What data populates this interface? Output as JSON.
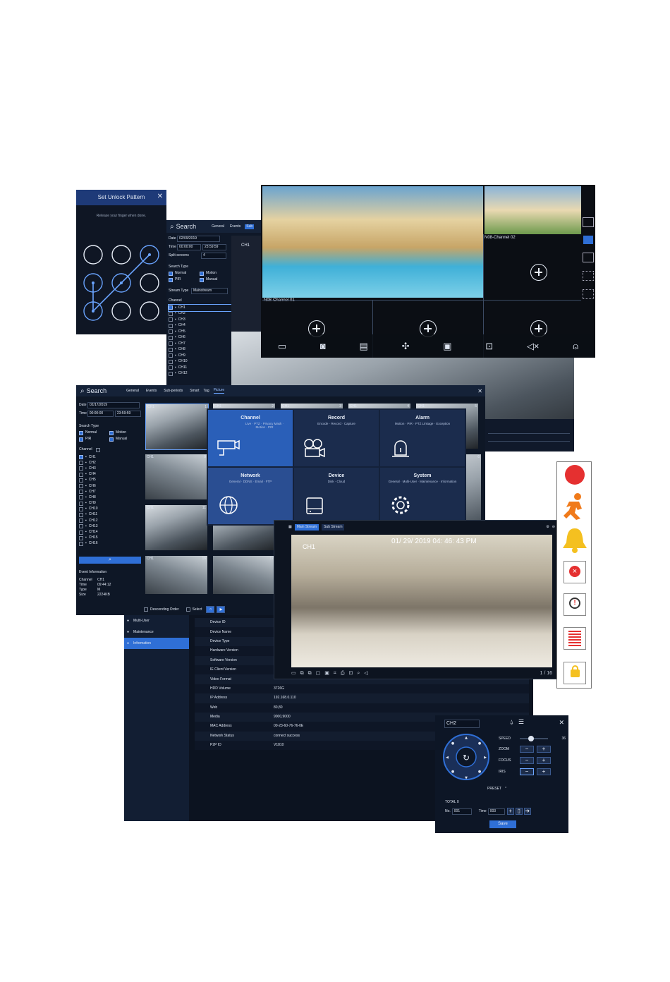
{
  "unlock": {
    "title": "Set Unlock Pattern",
    "hint": "Release your finger when done."
  },
  "search_back": {
    "title": "Search",
    "tabs": [
      "General",
      "Events",
      "Sub"
    ],
    "date_label": "Date",
    "date": "02/09/2019",
    "time_label": "Time",
    "time_start": "00:00:00",
    "time_end": "23:59:59",
    "split_label": "Split-screens",
    "split": "4",
    "search_type": "Search Type",
    "types": [
      "Normal",
      "Motion",
      "PIR",
      "Manual"
    ],
    "stream_label": "Stream Type",
    "stream": "Mainstream",
    "channel_label": "Channel",
    "channels": [
      "CH1",
      "CH2",
      "CH3",
      "CH4",
      "CH5",
      "CH6",
      "CH7",
      "CH8",
      "CH9",
      "CH10",
      "CH11",
      "CH12"
    ],
    "ch_label": "CH1"
  },
  "live": {
    "ch1": "N08-Channel 01",
    "ch2": "N08-Channel 02"
  },
  "search_front": {
    "title": "Search",
    "tabs": [
      "General",
      "Events",
      "Sub-periods",
      "Smart",
      "Tag",
      "Picture"
    ],
    "date_label": "Date",
    "date": "02/17/2019",
    "time_label": "Time",
    "time_start": "00:00:00",
    "time_end": "23:59:59",
    "search_type": "Search Type",
    "types": [
      "Normal",
      "Motion",
      "PIR",
      "Manual"
    ],
    "channel_label": "Channel",
    "channels": [
      "CH1",
      "CH2",
      "CH3",
      "CH4",
      "CH5",
      "CH6",
      "CH7",
      "CH8",
      "CH9",
      "CH10",
      "CH11",
      "CH12",
      "CH13",
      "CH14",
      "CH15",
      "CH16"
    ],
    "event_info": "Event Information",
    "ev_channel_label": "Channel",
    "ev_channel": "CH1",
    "ev_time_label": "Time",
    "ev_time": "09:44:12",
    "ev_type_label": "Type",
    "ev_type": "M",
    "ev_size_label": "Size",
    "ev_size": "2224KB",
    "descending": "Descending Order",
    "select": "Select",
    "thumb_labels": [
      "CH1",
      "CH1",
      "CH1",
      "CH1",
      "CH1",
      "CH1",
      "CH1",
      "CH1"
    ],
    "thumb_nums": [
      "1",
      "2",
      "3",
      "4",
      "5",
      "6",
      "9",
      "10",
      "11",
      "12",
      "16",
      "17"
    ]
  },
  "menu": {
    "tiles": [
      {
        "title": "Channel",
        "sub": "Live · PTZ · Privacy Mask · Motion · PIR"
      },
      {
        "title": "Record",
        "sub": "Encode · Record · Capture"
      },
      {
        "title": "Alarm",
        "sub": "Motion · PIR · PTZ Linkage · Exception"
      },
      {
        "title": "Network",
        "sub": "General · DDNS · Email · FTP"
      },
      {
        "title": "Device",
        "sub": "Disk · Cloud"
      },
      {
        "title": "System",
        "sub": "General · Multi-User · Maintenance · Information"
      }
    ]
  },
  "info": {
    "side": [
      "Multi-User",
      "Maintenance",
      "Information"
    ],
    "rows": [
      {
        "k": "Device ID",
        "v": ""
      },
      {
        "k": "Device Name",
        "v": ""
      },
      {
        "k": "Device Type",
        "v": ""
      },
      {
        "k": "Hardware Version",
        "v": ""
      },
      {
        "k": "Software Version",
        "v": ""
      },
      {
        "k": "IE Client Version",
        "v": ""
      },
      {
        "k": "Video Format",
        "v": ""
      },
      {
        "k": "HDD Volume",
        "v": "3726G"
      },
      {
        "k": "IP Address",
        "v": "192.168.0.110"
      },
      {
        "k": "Web",
        "v": "80,80"
      },
      {
        "k": "Media",
        "v": "9000,9000"
      },
      {
        "k": "MAC Address",
        "v": "00-23-60-76-76-0E"
      },
      {
        "k": "Network Status",
        "v": "connect success"
      },
      {
        "k": "P2P ID",
        "v": "V1810"
      }
    ]
  },
  "playback": {
    "tab1": "Main Stream",
    "tab2": "Sub Stream",
    "osd_ch": "CH1",
    "osd_time": "01/ 29/ 2019 04: 46: 43 PM",
    "page": "1 / 16"
  },
  "ptz": {
    "channel": "CH2",
    "speed_label": "SPEED",
    "speed_value": "36",
    "speed_level": 0.4,
    "zoom_label": "ZOOM",
    "focus_label": "FOCUS",
    "iris_label": "IRIS",
    "preset_label": "PRESET",
    "total_label": "TOTAL 0",
    "no_label": "No.",
    "no_value": "001",
    "time_label": "Time",
    "time_value": "003",
    "save_label": "Save"
  },
  "colors": {
    "accent": "#2f6fd6",
    "panel": "#10192a",
    "record_red": "#e53030",
    "motion_orange": "#f07a1a",
    "alarm_yellow": "#f4c020"
  }
}
